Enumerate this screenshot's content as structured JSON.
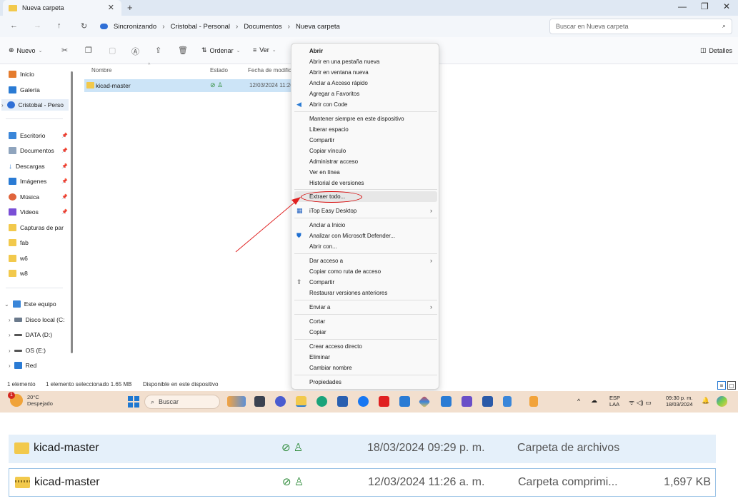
{
  "window": {
    "tab_title": "Nueva carpeta",
    "breadcrumb": [
      "Sincronizando",
      "Cristobal - Personal",
      "Documentos",
      "Nueva carpeta"
    ],
    "search_placeholder": "Buscar en Nueva carpeta"
  },
  "toolbar": {
    "new_label": "Nuevo",
    "sort_label": "Ordenar",
    "view_label": "Ver",
    "details_label": "Detalles"
  },
  "sidebar": {
    "items": [
      {
        "label": "Inicio",
        "icon": "home-icon"
      },
      {
        "label": "Galería",
        "icon": "gallery-icon"
      },
      {
        "label": "Cristobal - Perso",
        "icon": "onedrive-icon"
      },
      {
        "label": "Escritorio",
        "icon": "desktop-icon"
      },
      {
        "label": "Documentos",
        "icon": "documents-icon"
      },
      {
        "label": "Descargas",
        "icon": "downloads-icon"
      },
      {
        "label": "Imágenes",
        "icon": "pictures-icon"
      },
      {
        "label": "Música",
        "icon": "music-icon"
      },
      {
        "label": "Videos",
        "icon": "videos-icon"
      },
      {
        "label": "Capturas de par",
        "icon": "folder-icon"
      },
      {
        "label": "fab",
        "icon": "folder-icon"
      },
      {
        "label": "w6",
        "icon": "folder-icon"
      },
      {
        "label": "w8",
        "icon": "folder-icon"
      },
      {
        "label": "Este equipo",
        "icon": "pc-icon"
      },
      {
        "label": "Disco local (C:",
        "icon": "drive-icon"
      },
      {
        "label": "DATA (D:)",
        "icon": "drive-icon"
      },
      {
        "label": "OS (E:)",
        "icon": "drive-icon"
      },
      {
        "label": "Red",
        "icon": "network-icon"
      }
    ]
  },
  "filelist": {
    "headers": [
      "Nombre",
      "Estado",
      "Fecha de modific"
    ],
    "rows": [
      {
        "name": "kicad-master",
        "date": "12/03/2024 11:26"
      }
    ]
  },
  "statusbar": {
    "count": "1 elemento",
    "selection": "1 elemento seleccionado  1.65 MB",
    "availability": "Disponible en este dispositivo"
  },
  "context_menu": {
    "items": [
      "Abrir",
      "Abrir en una pestaña nueva",
      "Abrir en ventana nueva",
      "Anclar a Acceso rápido",
      "Agregar a Favoritos",
      "Abrir con Code",
      "Mantener siempre en este dispositivo",
      "Liberar espacio",
      "Compartir",
      "Copiar vínculo",
      "Administrar acceso",
      "Ver en línea",
      "Historial de versiones",
      "Extraer todo...",
      "iTop Easy Desktop",
      "Anclar a Inicio",
      "Analizar con Microsoft Defender...",
      "Abrir con...",
      "Dar acceso a",
      "Copiar como ruta de acceso",
      "Compartir",
      "Restaurar versiones anteriores",
      "Enviar a",
      "Cortar",
      "Copiar",
      "Crear acceso directo",
      "Eliminar",
      "Cambiar nombre",
      "Propiedades"
    ]
  },
  "taskbar": {
    "temperature": "20°C",
    "weather": "Despejado",
    "weather_badge": "1",
    "search_label": "Buscar",
    "lang": "ESP",
    "lang_sub": "LAA",
    "time": "09:30 p. m.",
    "date": "18/03/2024"
  },
  "zoom": {
    "rows": [
      {
        "name": "kicad-master",
        "date": "18/03/2024 09:29 p. m.",
        "type": "Carpeta de archivos",
        "size": ""
      },
      {
        "name": "kicad-master",
        "date": "12/03/2024 11:26 a. m.",
        "type": "Carpeta comprimi...",
        "size": "1,697 KB"
      }
    ]
  },
  "colors": {
    "accent": "#0067c0",
    "highlight_circle": "#d60000",
    "arrow": "#e02020",
    "selection": "#cce4f7",
    "taskbar": "#f2dfce"
  }
}
